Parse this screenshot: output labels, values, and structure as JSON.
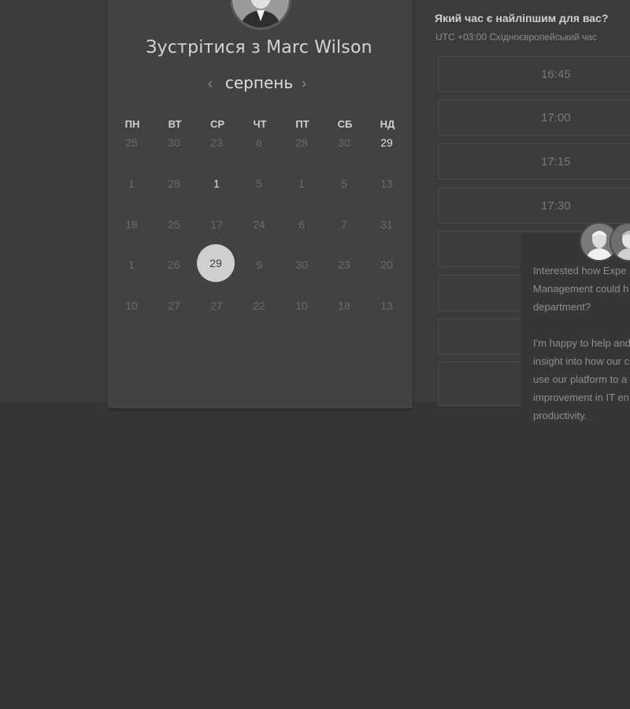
{
  "meeting": {
    "title": "Зустрітися з Marc Wilson"
  },
  "calendar": {
    "month": "серпень",
    "prev_icon": "chevron-left-icon",
    "next_icon": "chevron-right-icon",
    "weekdays": [
      "ПН",
      "ВТ",
      "СР",
      "ЧТ",
      "ПТ",
      "СБ",
      "НД"
    ],
    "weeks": [
      [
        "25",
        "30",
        "23",
        "6",
        "28",
        "30",
        "29"
      ],
      [
        "1",
        "28",
        "1",
        "5",
        "1",
        "5",
        "13"
      ],
      [
        "18",
        "25",
        "17",
        "24",
        "6",
        "7",
        "31"
      ],
      [
        "1",
        "26",
        "29",
        "9",
        "30",
        "23",
        "20"
      ],
      [
        "10",
        "27",
        "27",
        "22",
        "10",
        "18",
        "13"
      ]
    ],
    "active_days": [
      "w0d6",
      "w1d2"
    ],
    "selected_day": "29"
  },
  "times": {
    "question": "Який час є найліпшим для вас?",
    "timezone": "UTC +03:00 Східноєвропейський час",
    "slots": [
      "16:45",
      "17:00",
      "17:15",
      "17:30"
    ]
  },
  "chat": {
    "lines": [
      "Interested how Expe",
      "Management could h",
      "department?",
      "",
      "I'm happy to help and",
      "insight into how our c",
      "use our platform to a",
      "improvement in IT en",
      "productivity."
    ]
  },
  "colors": {
    "background": "#363636",
    "card": "#424242",
    "selected": "#cfcfcf"
  }
}
